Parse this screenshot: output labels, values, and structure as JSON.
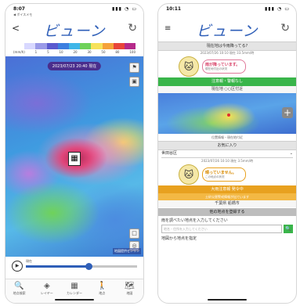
{
  "left": {
    "status": {
      "time": "8:07",
      "sub": "◀ ボイスメモ",
      "signal": "▮▮▮ ◔ ▭"
    },
    "header": {
      "back": "<",
      "logo": "ビューン",
      "refresh": "↻"
    },
    "legend": {
      "colors": [
        "#ffffff",
        "#d8d8ff",
        "#9a9ae8",
        "#5a5acf",
        "#3d7fe0",
        "#3fb6e8",
        "#6fd25a",
        "#f7e25a",
        "#f5a23a",
        "#e8453a",
        "#b52a8a"
      ],
      "labels": [
        "(mm/h)",
        "1",
        "5",
        "10",
        "20",
        "30",
        "50",
        "80",
        "100"
      ]
    },
    "map": {
      "time_badge": "2023/07/23 20:40 現在",
      "attribution": "地図提供ゼンリン"
    },
    "timeline": {
      "play": "▶",
      "caption": "現在"
    },
    "tabs": [
      {
        "icon": "🔍",
        "label": "地点検索"
      },
      {
        "icon": "◈",
        "label": "レイヤー"
      },
      {
        "icon": "▦",
        "label": "カレンダー"
      },
      {
        "icon": "🚶",
        "label": "地点"
      },
      {
        "icon": "🗺",
        "label": "地図"
      }
    ]
  },
  "right": {
    "status": {
      "time": "10:11",
      "signal": "▮▮▮ ◔ ▭"
    },
    "header": {
      "menu": "≡",
      "logo": "ビューン",
      "refresh": "↻"
    },
    "question": "現在地は今雨降ってる?",
    "sub_time": "2023/07/26 10:10 現在 33.5mm/時",
    "bubble": {
      "main": "雨が降っています。",
      "small": "現在地付近の状況"
    },
    "green_status": "注意報・警報なし",
    "plain_status": "現在地 ○○区付近",
    "map_caption": "位置情報・現在地付近",
    "favorites": "お気に入り",
    "select": "世田谷区",
    "sub_time2": "2023/07/26 10:10 現在 3.5mm/時",
    "bubble2": {
      "main": "晴っていません。",
      "small": "この地点の状況"
    },
    "orange_status": "大雨注意報 発令中",
    "orange_sub": "土砂災害警戒情報が出ています",
    "plain2": "千葉県 船橋市",
    "gray_btn": "他の地点を登録する",
    "search_label": "雨を調べたい地点を入力してください",
    "search_placeholder": "地名・住所を入力してください",
    "search_go": "🔍",
    "bottom_label": "地図から地点を指定"
  }
}
